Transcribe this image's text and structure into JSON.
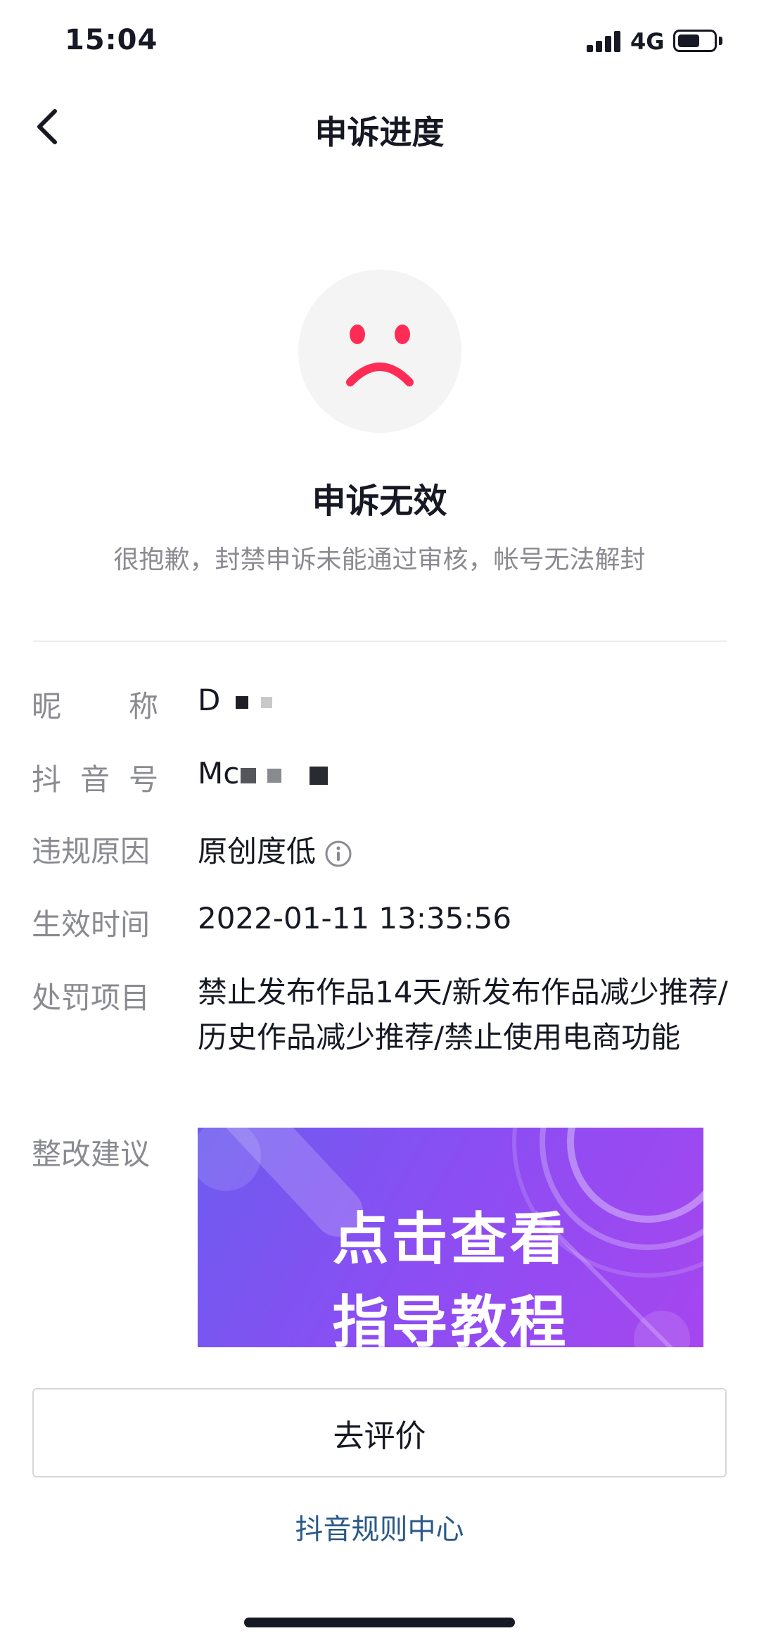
{
  "status_bar": {
    "time": "15:04",
    "network": "4G"
  },
  "nav": {
    "title": "申诉进度"
  },
  "result": {
    "title": "申诉无效",
    "description": "很抱歉，封禁申诉未能通过审核，帐号无法解封"
  },
  "info": {
    "nickname": {
      "label_chars": [
        "昵",
        "称"
      ],
      "value_visible": "D"
    },
    "douyin_id": {
      "label_chars": [
        "抖",
        "音",
        "号"
      ],
      "value_visible": "Mc"
    },
    "violation": {
      "label": "违规原因",
      "value": "原创度低"
    },
    "effective_time": {
      "label": "生效时间",
      "value": "2022-01-11 13:35:56"
    },
    "penalty": {
      "label": "处罚项目",
      "value": "禁止发布作品14天/新发布作品减少推荐/历史作品减少推荐/禁止使用电商功能"
    },
    "suggestion": {
      "label": "整改建议"
    }
  },
  "banner": {
    "line1": "点击查看",
    "line2": "指导教程"
  },
  "actions": {
    "rate_button": "去评价",
    "rules_link": "抖音规则中心"
  },
  "colors": {
    "accent_sad": "#fe2c55",
    "link": "#2b5a87",
    "label": "#8a8b91"
  }
}
